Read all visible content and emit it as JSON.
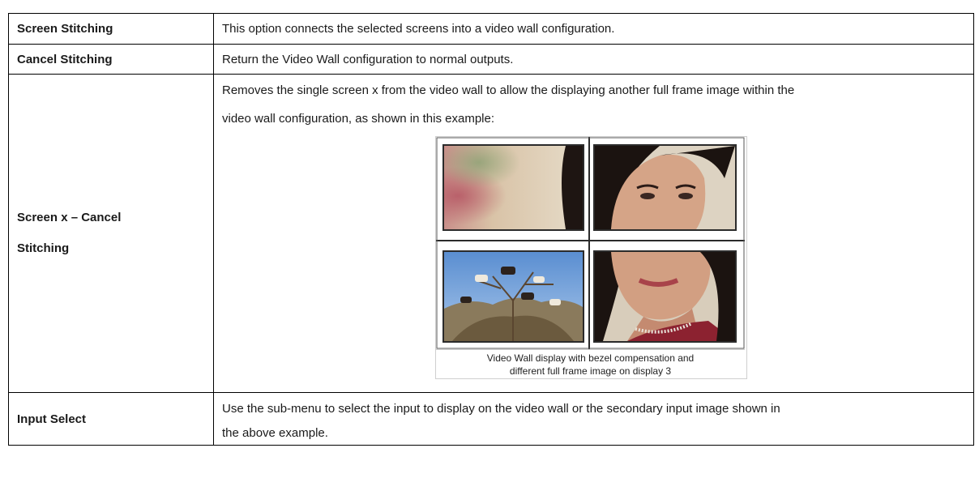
{
  "rows": [
    {
      "term": "Screen Stitching",
      "description": "This option connects the selected screens into a video wall configuration."
    },
    {
      "term": "Cancel Stitching",
      "description": "Return the Video Wall configuration to normal outputs."
    },
    {
      "term_line1": "Screen x – Cancel",
      "term_line2": "Stitching",
      "description_line1": "Removes the single screen x from the video wall to allow the displaying another full frame image within the",
      "description_line2": "video wall configuration, as shown in this example:",
      "figure_caption_line1": "Video Wall display with bezel compensation and",
      "figure_caption_line2": "different full frame image on display 3"
    },
    {
      "term": "Input Select",
      "description_line1": "Use the sub-menu to select the input to display on the video wall or the secondary input image shown in",
      "description_line2": "the above example."
    }
  ]
}
